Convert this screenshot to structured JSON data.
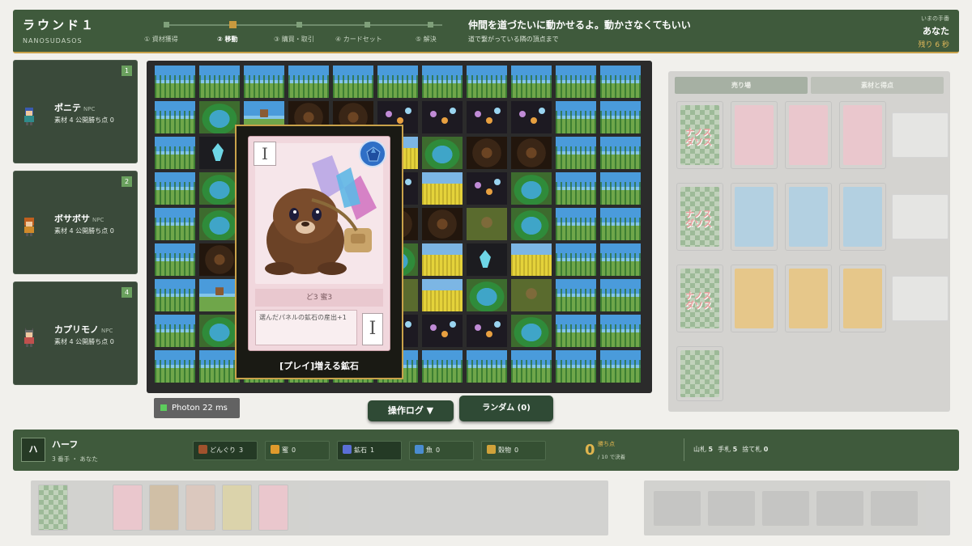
{
  "header": {
    "round_title": "ラウンド１",
    "brand": "NANOSUDASOS",
    "phases": [
      "① 資材獲得",
      "② 移動",
      "③ 購買・取引",
      "④ カードセット",
      "⑤ 解決"
    ],
    "active_phase": 2,
    "instruction_main": "仲間を道づたいに動かせるよ。動かさなくてもいい",
    "instruction_sub": "道で繋がっている隣の頂点まで",
    "turn_label": "いまの手番",
    "turn_name": "あなた",
    "time_left": "残り 6 秒"
  },
  "players": [
    {
      "order": "1",
      "name": "ポニテ",
      "tag": "NPC",
      "stats": "素材 4  公開勝ち点 0"
    },
    {
      "order": "2",
      "name": "ボサボサ",
      "tag": "NPC",
      "stats": "素材 4  公開勝ち点 0"
    },
    {
      "order": "4",
      "name": "カプリモノ",
      "tag": "NPC",
      "stats": "素材 4  公開勝ち点 0"
    }
  ],
  "popup": {
    "grade": "I",
    "cost": "ど3 蜜3",
    "effect": "選んだパネルの鉱石の産出+1",
    "caption": "[プレイ]増える鉱石"
  },
  "latency": "Photon  22 ms",
  "buttons": {
    "log": "操作ログ ▼",
    "random": "ランダム (0)"
  },
  "market": {
    "tabs": [
      "売り場",
      "素材と得点"
    ],
    "deck_logo": "ナノス\nダソス",
    "colors": {
      "tier1": "#e9c1c8",
      "tier2": "#a9cbe0",
      "tier3": "#e5c07a"
    }
  },
  "player_bar": {
    "icon": "ハ",
    "name": "ハーフ",
    "sub": "3 番手  ・  あなた",
    "resources": [
      {
        "name": "どんぐり",
        "count": "3",
        "color": "#a0522d",
        "owned": true
      },
      {
        "name": "蜜",
        "count": "0",
        "color": "#e09a2c",
        "owned": false
      },
      {
        "name": "鉱石",
        "count": "1",
        "color": "#5b6fd6",
        "owned": true
      },
      {
        "name": "魚",
        "count": "0",
        "color": "#4a8cd0",
        "owned": false
      },
      {
        "name": "穀物",
        "count": "0",
        "color": "#d0a23a",
        "owned": false
      }
    ],
    "vp_value": "0",
    "vp_label": "勝ち点",
    "vp_sub": "/ 10 で決着",
    "piles": [
      {
        "label": "山札",
        "value": "5"
      },
      {
        "label": "手札",
        "value": "5"
      },
      {
        "label": "捨て札",
        "value": "0"
      }
    ]
  },
  "board": {
    "rows": [
      [
        "grass",
        "grass",
        "grass",
        "grass",
        "grass",
        "grass",
        "grass",
        "grass",
        "grass",
        "grass",
        "grass"
      ],
      [
        "grass",
        "pond",
        "pawn",
        "cave",
        "cave",
        "night",
        "night",
        "night",
        "night",
        "grass",
        "grass"
      ],
      [
        "grass",
        "crystal",
        "pond",
        "pond",
        "forest",
        "field",
        "pond",
        "cave",
        "cave",
        "grass",
        "grass"
      ],
      [
        "grass",
        "pond",
        "pond",
        "cave",
        "cave",
        "night",
        "field",
        "night",
        "pond",
        "grass",
        "grass"
      ],
      [
        "grass",
        "pond",
        "forest",
        "night",
        "night",
        "cave",
        "cave",
        "forest",
        "pond",
        "grass",
        "grass"
      ],
      [
        "grass",
        "cave",
        "pond",
        "pond",
        "forest",
        "pond",
        "field",
        "crystal",
        "field",
        "grass",
        "grass"
      ],
      [
        "grass",
        "pawn",
        "field",
        "field",
        "cave",
        "forest",
        "field",
        "pond",
        "forest",
        "grass",
        "grass"
      ],
      [
        "grass",
        "pond",
        "forest",
        "night",
        "night",
        "night",
        "night",
        "night",
        "pond",
        "grass",
        "grass"
      ],
      [
        "grass",
        "grass",
        "grass",
        "grass",
        "grass",
        "grass",
        "grass",
        "grass",
        "grass",
        "grass",
        "grass"
      ]
    ]
  }
}
